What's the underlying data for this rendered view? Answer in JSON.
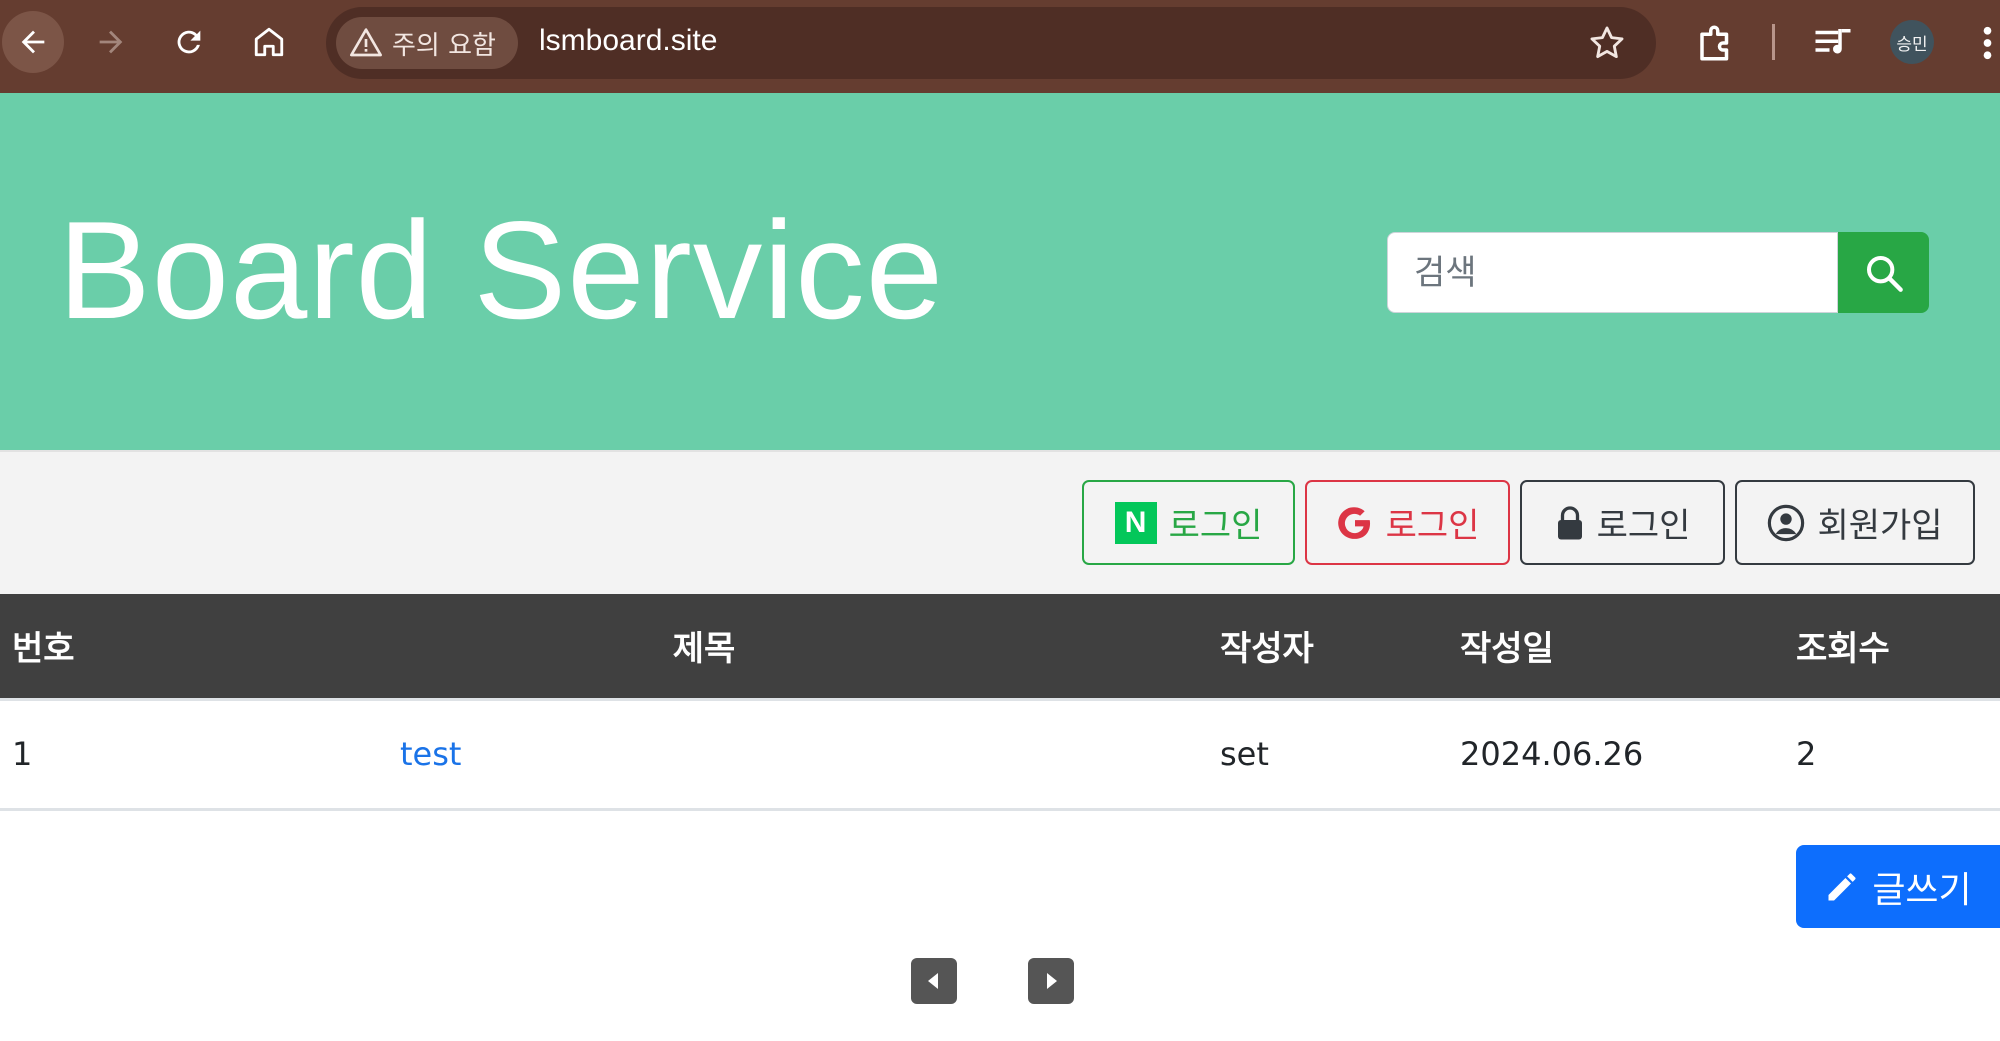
{
  "browser": {
    "security_chip": "주의 요함",
    "url": "lsmboard.site",
    "profile_initials": "승민"
  },
  "header": {
    "title": "Board Service",
    "search_placeholder": "검색"
  },
  "auth": {
    "naver_login": "로그인",
    "naver_logo_letter": "N",
    "google_login": "로그인",
    "local_login": "로그인",
    "signup": "회원가입"
  },
  "table": {
    "columns": [
      "번호",
      "제목",
      "작성자",
      "작성일",
      "조회수"
    ],
    "rows": [
      {
        "no": "1",
        "title": "test",
        "author": "set",
        "date": "2024.06.26",
        "views": "2"
      }
    ]
  },
  "actions": {
    "write": "글쓰기"
  },
  "colors": {
    "chrome_bg": "#653d30",
    "header_bg": "#6acea9",
    "search_btn": "#28a745",
    "table_header": "#404040",
    "write_btn": "#0d6efd",
    "link": "#1a73e8"
  }
}
